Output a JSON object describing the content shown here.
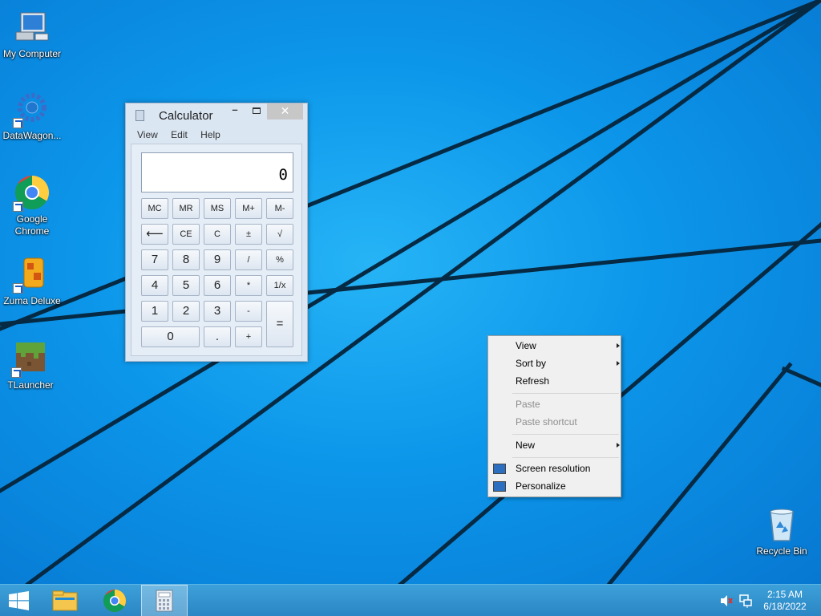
{
  "desktop": {
    "icons": [
      {
        "label": "My Computer",
        "icon": "computer-icon",
        "shortcut": false
      },
      {
        "label": "DataWagon...",
        "icon": "gear-icon",
        "shortcut": true
      },
      {
        "label": "Google Chrome",
        "icon": "chrome-icon",
        "shortcut": true
      },
      {
        "label": "Zuma Deluxe",
        "icon": "zuma-frog-icon",
        "shortcut": true
      },
      {
        "label": "TLauncher",
        "icon": "minecraft-grass-block-icon",
        "shortcut": true
      }
    ],
    "recycle_bin": {
      "label": "Recycle Bin",
      "icon": "recycle-bin-icon"
    }
  },
  "calculator": {
    "title": "Calculator",
    "menu": [
      "View",
      "Edit",
      "Help"
    ],
    "display": "0",
    "keys": {
      "mc": "MC",
      "mr": "MR",
      "ms": "MS",
      "mplus": "M+",
      "mminus": "M-",
      "back": "⟵",
      "ce": "CE",
      "c": "C",
      "neg": "±",
      "sqrt": "√",
      "k7": "7",
      "k8": "8",
      "k9": "9",
      "div": "/",
      "pct": "%",
      "k4": "4",
      "k5": "5",
      "k6": "6",
      "mul": "*",
      "recip": "1/x",
      "k1": "1",
      "k2": "2",
      "k3": "3",
      "sub": "-",
      "eq": "=",
      "k0": "0",
      "dot": ".",
      "add": "+"
    },
    "window_buttons": {
      "minimize": "–",
      "close": "✕"
    }
  },
  "context_menu": {
    "view": "View",
    "sort_by": "Sort by",
    "refresh": "Refresh",
    "paste": "Paste",
    "paste_shortcut": "Paste shortcut",
    "new": "New",
    "screen_resolution": "Screen resolution",
    "personalize": "Personalize"
  },
  "taskbar": {
    "start": "windows-logo-icon",
    "pinned": [
      "file-explorer-icon",
      "chrome-icon",
      "calculator-icon"
    ],
    "active": "calculator-icon",
    "tray": [
      "volume-muted-icon",
      "network-icon"
    ],
    "time": "2:15 AM",
    "date": "6/18/2022"
  },
  "colors": {
    "desktop_blue": "#0c96ea",
    "taskbar": "#2a86c4",
    "close_button": "#c7c7c7"
  }
}
